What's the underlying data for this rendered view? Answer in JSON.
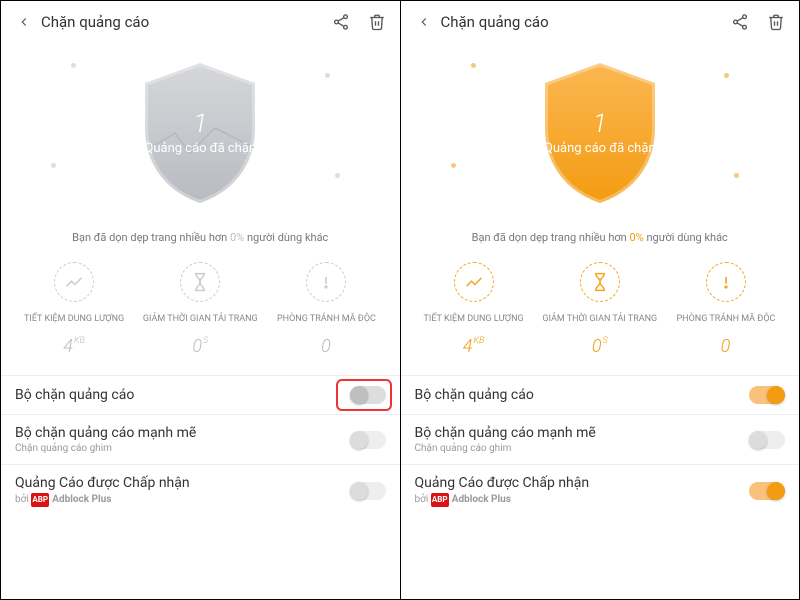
{
  "left": {
    "header": {
      "title": "Chặn quảng cáo"
    },
    "shield": {
      "count": "1",
      "label": "Quảng cáo đã chặn"
    },
    "subtext_prefix": "Bạn đã dọn dẹp trang nhiều hơn ",
    "subtext_pct": "0%",
    "subtext_suffix": " người dùng khác",
    "stats": [
      {
        "label": "TIẾT KIỆM DUNG LƯỢNG",
        "value": "4",
        "unit": "KB"
      },
      {
        "label": "GIẢM THỜI GIAN TẢI TRANG",
        "value": "0",
        "unit": "S"
      },
      {
        "label": "PHÒNG TRÁNH MÃ ĐỘC",
        "value": "0",
        "unit": ""
      }
    ],
    "rows": [
      {
        "label": "Bộ chặn quảng cáo",
        "sub": "",
        "toggle": "off",
        "highlight": true
      },
      {
        "label": "Bộ chặn quảng cáo mạnh mẽ",
        "sub": "Chặn quảng cáo ghim",
        "toggle": "offgrey"
      },
      {
        "label": "Quảng Cáo được Chấp nhận",
        "sub_html": "abp",
        "sub": "Adblock Plus",
        "sub_prefix": "bởi ",
        "toggle": "offgrey"
      }
    ]
  },
  "right": {
    "header": {
      "title": "Chặn quảng cáo"
    },
    "shield": {
      "count": "1",
      "label": "Quảng cáo đã chặn"
    },
    "subtext_prefix": "Bạn đã dọn dẹp trang nhiều hơn ",
    "subtext_pct": "0%",
    "subtext_suffix": " người dùng khác",
    "stats": [
      {
        "label": "TIẾT KIỆM DUNG LƯỢNG",
        "value": "4",
        "unit": "KB"
      },
      {
        "label": "GIẢM THỜI GIAN TẢI TRANG",
        "value": "0",
        "unit": "S"
      },
      {
        "label": "PHÒNG TRÁNH MÃ ĐỘC",
        "value": "0",
        "unit": ""
      }
    ],
    "rows": [
      {
        "label": "Bộ chặn quảng cáo",
        "sub": "",
        "toggle": "on"
      },
      {
        "label": "Bộ chặn quảng cáo mạnh mẽ",
        "sub": "Chặn quảng cáo ghim",
        "toggle": "offgrey"
      },
      {
        "label": "Quảng Cáo được Chấp nhận",
        "sub_html": "abp",
        "sub": "Adblock Plus",
        "sub_prefix": "bởi ",
        "toggle": "on"
      }
    ]
  }
}
